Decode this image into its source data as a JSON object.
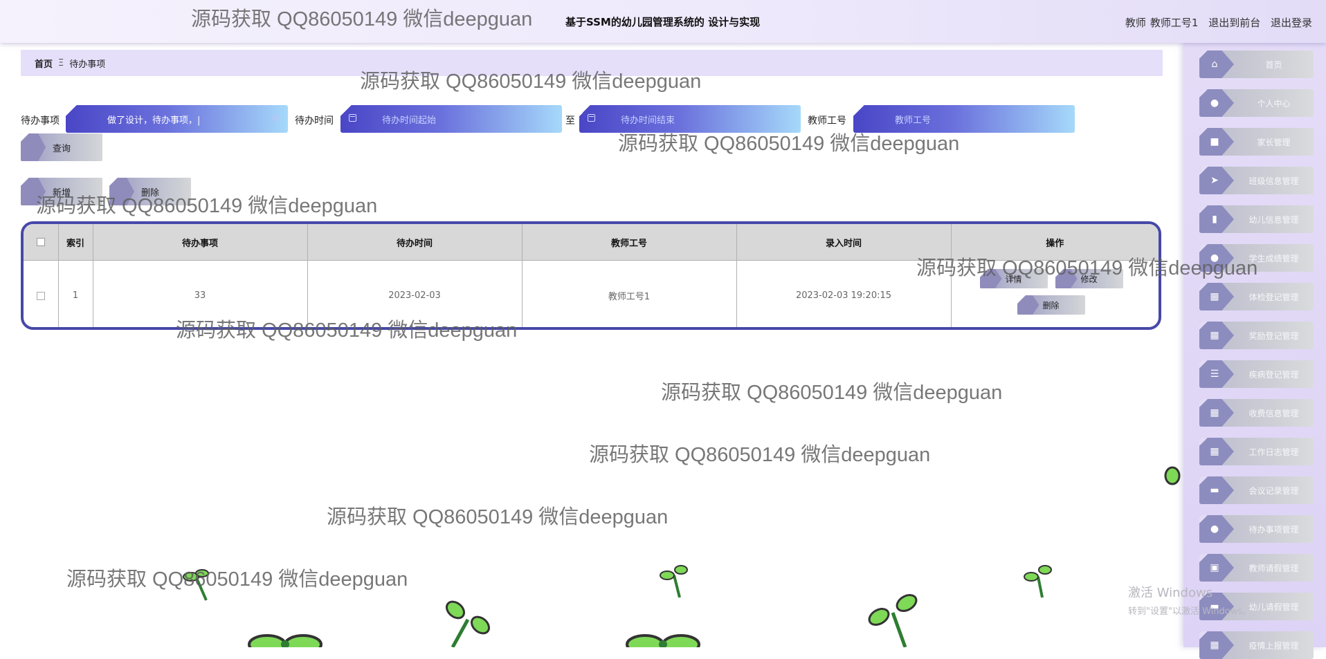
{
  "header": {
    "title": "基于SSM的幼儿园管理系统的 设计与实现",
    "user_role": "教师",
    "user_name": "教师工号1",
    "to_front_label": "退出到前台",
    "logout_label": "退出登录"
  },
  "breadcrumb": {
    "home": "首页",
    "separator": "Ξ",
    "current": "待办事项"
  },
  "search": {
    "item_label": "待办事项",
    "item_value": "做了设计，待办事项，|",
    "time_label": "待办时间",
    "time_start_placeholder": "待办时间起始",
    "time_to": "至",
    "time_end_placeholder": "待办时间结束",
    "teacher_label": "教师工号",
    "teacher_placeholder": "教师工号",
    "query_button": "查询"
  },
  "actions": {
    "add_button": "新增",
    "delete_button": "删除"
  },
  "table": {
    "headers": [
      "索引",
      "待办事项",
      "待办时间",
      "教师工号",
      "录入时间",
      "操作"
    ],
    "rows": [
      {
        "index": "1",
        "item": "33",
        "time": "2023-02-03",
        "teacher_no": "教师工号1",
        "created": "2023-02-03 19:20:15",
        "detail_label": "详情",
        "edit_label": "修改",
        "delete_label": "删除"
      }
    ]
  },
  "sidebar": {
    "items": [
      {
        "label": "首页",
        "icon": "home-icon"
      },
      {
        "label": "个人中心",
        "icon": "user-icon"
      },
      {
        "label": "家长管理",
        "icon": "briefcase-icon"
      },
      {
        "label": "班级信息管理",
        "icon": "send-icon"
      },
      {
        "label": "幼儿信息管理",
        "icon": "bar-chart-icon"
      },
      {
        "label": "学生成绩管理",
        "icon": "circle-icon"
      },
      {
        "label": "体检登记管理",
        "icon": "grid-icon"
      },
      {
        "label": "奖励登记管理",
        "icon": "grid-icon"
      },
      {
        "label": "疾病登记管理",
        "icon": "list-icon"
      },
      {
        "label": "收费信息管理",
        "icon": "grid-icon"
      },
      {
        "label": "工作日志管理",
        "icon": "calendar-icon"
      },
      {
        "label": "会议记录管理",
        "icon": "printer-icon"
      },
      {
        "label": "待办事项管理",
        "icon": "user-icon"
      },
      {
        "label": "教师请假管理",
        "icon": "clipboard-icon"
      },
      {
        "label": "幼儿请假管理",
        "icon": "printer-icon"
      },
      {
        "label": "疫情上报管理",
        "icon": "grid-icon"
      }
    ]
  },
  "watermark": "源码获取 QQ86050149 微信deepguan",
  "os_notice": {
    "line1": "激活 Windows",
    "line2": "转到\"设置\"以激活 Windows。"
  },
  "colors": {
    "accent": "#4648a8",
    "field_gradient_start": "#4a46c6",
    "field_gradient_end": "#a6d9fa",
    "sidebar_bg": "#e4dcf7",
    "breadcrumb_bg": "#e5dffa"
  }
}
